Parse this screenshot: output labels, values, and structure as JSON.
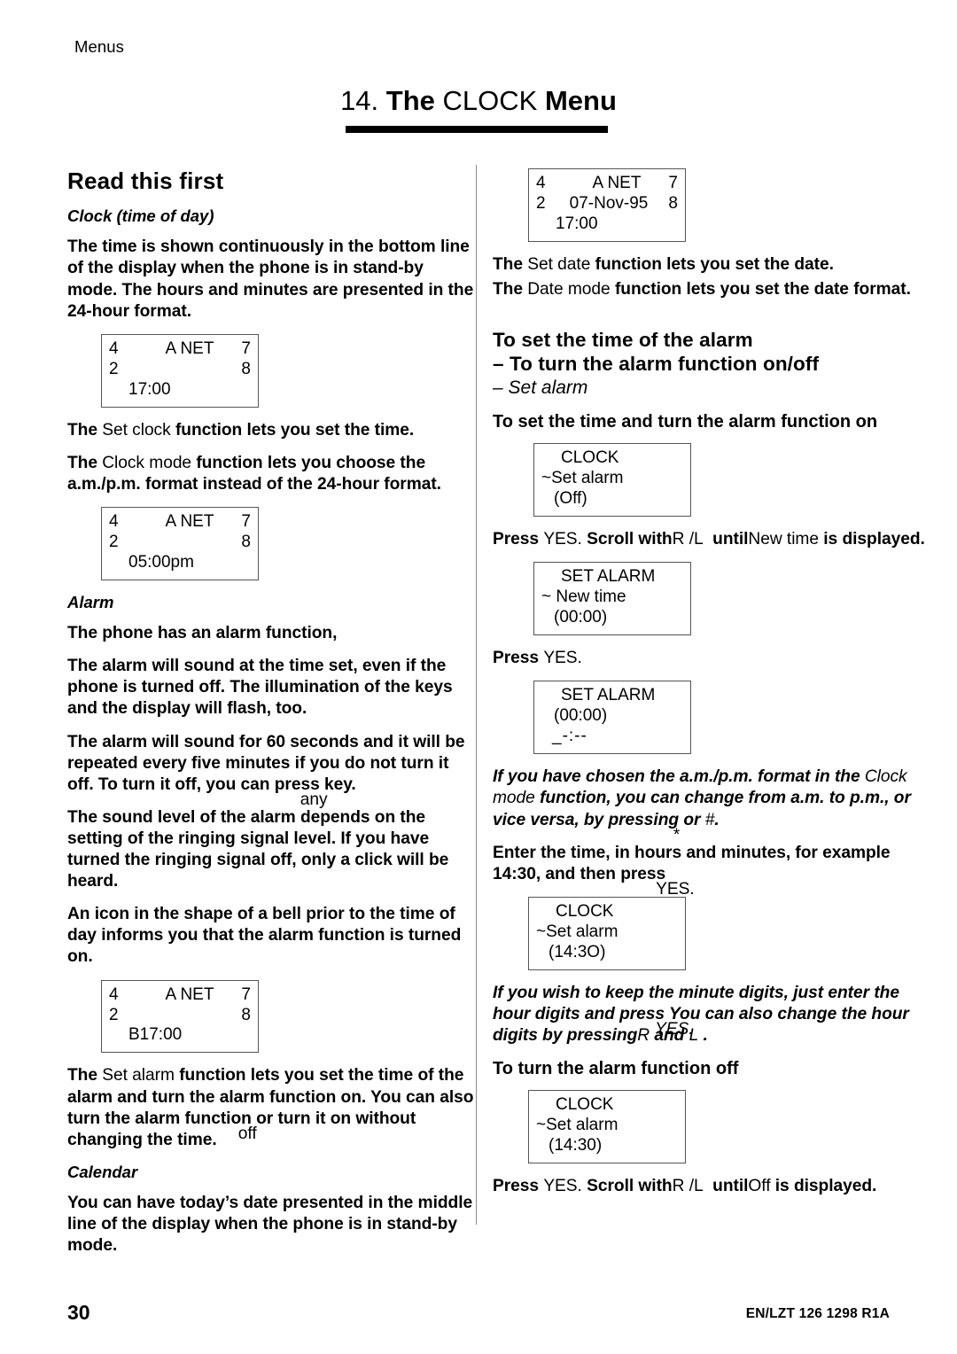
{
  "page": {
    "running_head": "Menus",
    "folio": "30",
    "doc_id": "EN/LZT 126 1298  R1A"
  },
  "chapter": {
    "number": "14.",
    "the": "The",
    "name": "CLOCK",
    "menu": "Menu"
  },
  "left_column": {
    "heading": "Read this first",
    "clock_subhead": "Clock (time of day)",
    "p_time_shown": "The time is shown continuously in the bottom line of the display when the phone is in stand-by mode. The hours and minutes are presented in the 24-hour format.",
    "display_1": {
      "left_top": "4",
      "left_bottom": "2",
      "net": "A NET",
      "right_top": "7",
      "right_bottom": "8",
      "middle": "",
      "bottom": "17:00"
    },
    "p_set_clock_pre": "The",
    "p_set_clock_lit": "Set clock",
    "p_set_clock_post": "function lets you set the time.",
    "p_clock_mode_pre": "The",
    "p_clock_mode_lit": "Clock mode",
    "p_clock_mode_post": "function lets you choose the a.m./p.m. format instead of the 24-hour format.",
    "display_2": {
      "left_top": "4",
      "left_bottom": "2",
      "net": "A NET",
      "right_top": "7",
      "right_bottom": "8",
      "bottom": "05:00pm"
    },
    "alarm_subhead": "Alarm",
    "p_alarm_1": "The phone has an alarm function,",
    "p_alarm_2": "The alarm will sound at the time set, even if the phone is turned off. The illumination of the keys and the display will flash, too.",
    "p_alarm_3a": "The alarm will sound for 60 seconds and it will be repeated every five minutes if you do not turn it off. To turn it off, you can press",
    "p_alarm_3_overlap": "any",
    "p_alarm_3b": "key.",
    "p_alarm_4": "The sound level of the alarm depends on the setting of the ringing signal level. If you have turned the ringing signal off, only a click will be heard.",
    "p_alarm_5": "An icon in the shape of a bell prior to the time of day informs you that the alarm function is turned on.",
    "display_3": {
      "left_top": "4",
      "left_bottom": "2",
      "net": "A NET",
      "right_top": "7",
      "right_bottom": "8",
      "bottom": "B17:00"
    },
    "p_set_alarm_pre": "The",
    "p_set_alarm_lit": "Set alarm",
    "p_set_alarm_mid": "function lets you set the time of the alarm and turn the alarm function on. You can also turn the alarm function",
    "p_set_alarm_overlap": "off",
    "p_set_alarm_post": "or turn it on without changing the time.",
    "calendar_subhead": "Calendar",
    "p_calendar": "You can have today’s date presented in the middle line of the display when the phone is in stand-by mode."
  },
  "right_column": {
    "display_4": {
      "left_top": "4",
      "left_bottom": "2",
      "net": "A NET",
      "right_top": "7",
      "right_bottom": "8",
      "middle": "07-Nov-95",
      "bottom": "17:00"
    },
    "p_set_date_pre": "The",
    "p_set_date_lit": "Set date",
    "p_set_date_post": "function lets you set the date.",
    "p_date_mode_pre": "The",
    "p_date_mode_lit": "Date mode",
    "p_date_mode_post": "function lets you set the date format.",
    "heading_line_1": "To set the time of the alarm",
    "heading_line_2": "– To turn the alarm function on/off",
    "heading_line_3_dash": "–",
    "heading_line_3_lit": "Set alarm",
    "subhead_set_on": "To set the time and turn the alarm function on",
    "display_5": {
      "l1": "CLOCK",
      "l2": "~Set alarm",
      "l3": "(Off)"
    },
    "press_1": {
      "press": "Press",
      "yes": "YES.",
      "scroll_with": "Scroll with",
      "key_r": "R",
      "slash": "/",
      "key_l": "L",
      "until": "until",
      "target": "New time",
      "is_displayed": "is displayed."
    },
    "display_6": {
      "l1": "SET ALARM",
      "l2": "~ New time",
      "l3": "(00:00)"
    },
    "press_2": {
      "press": "Press",
      "yes": "YES."
    },
    "display_7": {
      "l1": "SET ALARM",
      "l2": "(00:00)",
      "l3": "_-:--"
    },
    "note_ampm_a": "If you have chosen the a.m./p.m. format in the",
    "note_ampm_lit": "Clock mode",
    "note_ampm_b": "function, you can change from a.m. to p.m., or vice versa, by pressing",
    "note_ampm_star": "*",
    "note_ampm_or": "or",
    "note_ampm_hash": "#",
    "note_ampm_end": ".",
    "p_enter_time_a": "Enter the time, in hours and minutes, for example 14:30, and then press",
    "p_enter_time_yes": "YES.",
    "display_8": {
      "l1": "CLOCK",
      "l2": "~Set alarm",
      "l3": "(14:3O)"
    },
    "note_minute_a": "If you wish to keep the minute digits, just enter the hour digits and press",
    "note_minute_yes": "YES.",
    "note_minute_b": "You can also change the hour digits by pressing",
    "note_minute_r": "R",
    "note_minute_and": "and",
    "note_minute_l": "L",
    "note_minute_end": ".",
    "subhead_turn_off": "To turn the alarm function off",
    "display_9": {
      "l1": "CLOCK",
      "l2": "~Set alarm",
      "l3": "(14:30)"
    },
    "press_3": {
      "press": "Press",
      "yes": "YES.",
      "scroll_with": "Scroll with",
      "key_r": "R",
      "slash": "/",
      "key_l": "L",
      "until": "until",
      "target": "Off",
      "is_displayed": "is displayed."
    }
  }
}
